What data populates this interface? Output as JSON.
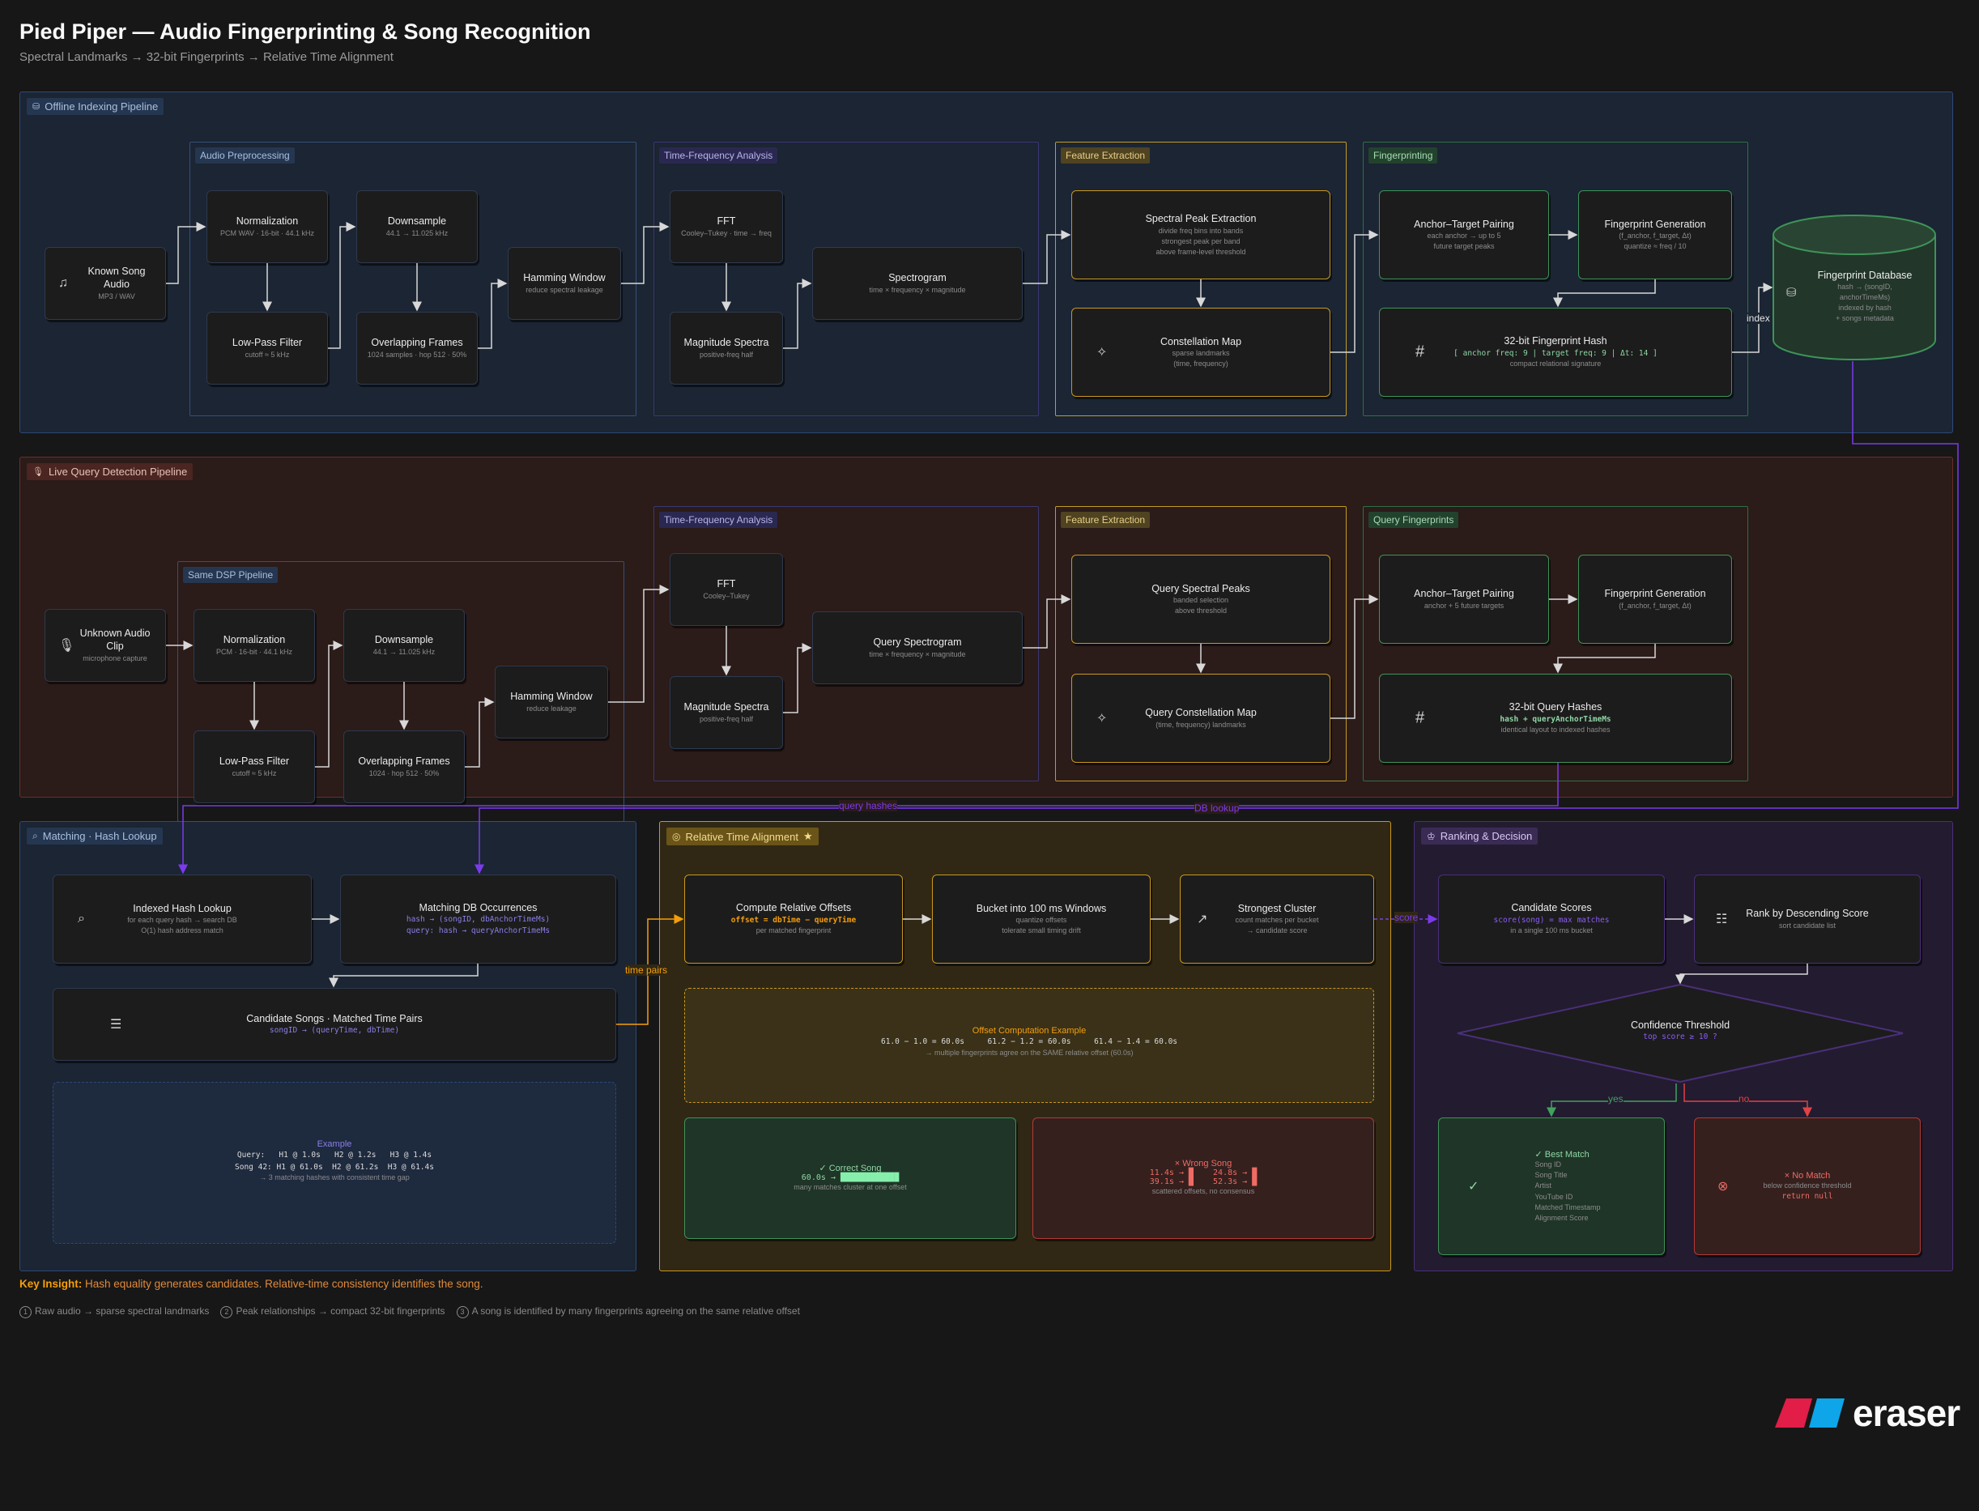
{
  "title": "Pied Piper — Audio Fingerprinting & Song Recognition",
  "subtitle": "Spectral Landmarks → 32-bit Fingerprints → Relative Time Alignment",
  "colors": {
    "background": "#171717",
    "blue": "#2d4a78",
    "red": "#6a2f2b",
    "gold": "#c9971f",
    "green": "#3e9358",
    "purple": "#7c3aed",
    "orange": "#f59e0b"
  },
  "offline": {
    "label": "Offline Indexing Pipeline",
    "icon": "database-icon",
    "groups": {
      "preprocessing": "Audio Preprocessing",
      "tfa": "Time-Frequency Analysis",
      "feature": "Feature Extraction",
      "fingerprinting": "Fingerprinting"
    },
    "nodes": {
      "known_song": {
        "title": "Known Song Audio",
        "sub": "MP3 / WAV"
      },
      "normalization": {
        "title": "Normalization",
        "sub": "PCM WAV · 16-bit · 44.1 kHz"
      },
      "lowpass": {
        "title": "Low-Pass Filter",
        "sub": "cutoff ≈ 5 kHz"
      },
      "downsample": {
        "title": "Downsample",
        "sub": "44.1 → 11.025 kHz"
      },
      "frames": {
        "title": "Overlapping Frames",
        "sub": "1024 samples · hop 512 · 50%"
      },
      "hamming": {
        "title": "Hamming Window",
        "sub": "reduce spectral leakage"
      },
      "fft": {
        "title": "FFT",
        "sub": "Cooley–Tukey · time → freq"
      },
      "magnitude": {
        "title": "Magnitude Spectra",
        "sub": "positive-freq half"
      },
      "spectrogram": {
        "title": "Spectrogram",
        "sub": "time × frequency × magnitude"
      },
      "peaks": {
        "title": "Spectral Peak Extraction",
        "sub": "divide freq bins into bands\nstrongest peak per band\nabove frame-level threshold"
      },
      "constellation": {
        "title": "Constellation Map",
        "sub": "sparse landmarks\n(time, frequency)"
      },
      "pairing": {
        "title": "Anchor–Target Pairing",
        "sub": "each anchor → up to 5\nfuture target peaks"
      },
      "fpgen": {
        "title": "Fingerprint Generation",
        "sub": "(f_anchor, f_target, Δt)\nquantize ≈ freq / 10"
      },
      "hash": {
        "title": "32-bit Fingerprint Hash",
        "code": "[ anchor freq: 9 | target freq: 9 | Δt: 14 ]",
        "sub": "compact relational signature"
      },
      "db": {
        "title": "Fingerprint Database",
        "sub": "hash → (songID,\nanchorTimeMs)\nindexed by hash\n+ songs metadata"
      }
    },
    "edge_index": "index"
  },
  "live": {
    "label": "Live Query Detection Pipeline",
    "icon": "microphone-icon",
    "groups": {
      "dsp": "Same DSP Pipeline",
      "tfa": "Time-Frequency Analysis",
      "feature": "Feature Extraction",
      "query_fp": "Query Fingerprints"
    },
    "nodes": {
      "unknown": {
        "title": "Unknown Audio Clip",
        "sub": "microphone capture"
      },
      "normalization": {
        "title": "Normalization",
        "sub": "PCM · 16-bit · 44.1 kHz"
      },
      "lowpass": {
        "title": "Low-Pass Filter",
        "sub": "cutoff ≈ 5 kHz"
      },
      "downsample": {
        "title": "Downsample",
        "sub": "44.1 → 11.025 kHz"
      },
      "frames": {
        "title": "Overlapping Frames",
        "sub": "1024 · hop 512 · 50%"
      },
      "hamming": {
        "title": "Hamming Window",
        "sub": "reduce leakage"
      },
      "fft": {
        "title": "FFT",
        "sub": "Cooley–Tukey"
      },
      "magnitude": {
        "title": "Magnitude Spectra",
        "sub": "positive-freq half"
      },
      "spectrogram": {
        "title": "Query Spectrogram",
        "sub": "time × frequency × magnitude"
      },
      "peaks": {
        "title": "Query Spectral Peaks",
        "sub": "banded selection\nabove threshold"
      },
      "constellation": {
        "title": "Query Constellation Map",
        "sub": "(time, frequency) landmarks"
      },
      "pairing": {
        "title": "Anchor–Target Pairing",
        "sub": "anchor + 5 future targets"
      },
      "fpgen": {
        "title": "Fingerprint Generation",
        "sub": "(f_anchor, f_target, Δt)"
      },
      "hashes": {
        "title": "32-bit Query Hashes",
        "code": "hash + queryAnchorTimeMs",
        "sub": "identical layout to indexed hashes"
      }
    },
    "edge_query_hashes": "query hashes",
    "edge_db_lookup": "DB lookup"
  },
  "matching": {
    "label": "Matching · Hash Lookup",
    "icon": "search-icon",
    "nodes": {
      "lookup": {
        "title": "Indexed Hash Lookup",
        "sub": "for each query hash → search DB\nO(1) hash address match"
      },
      "occurrences": {
        "title": "Matching DB Occurrences",
        "code": "hash → (songID, dbAnchorTimeMs)\nquery: hash → queryAnchorTimeMs"
      },
      "candidates": {
        "title": "Candidate Songs · Matched Time Pairs",
        "code": "songID → (queryTime, dbTime)"
      }
    },
    "example": {
      "title": "Example",
      "lines": "Query:   H1 @ 1.0s   H2 @ 1.2s   H3 @ 1.4s\nSong 42: H1 @ 61.0s  H2 @ 61.2s  H3 @ 61.4s",
      "note": "→ 3 matching hashes with consistent time gap"
    }
  },
  "alignment": {
    "label": "Relative Time Alignment",
    "star": "★",
    "edge_time_pairs": "time pairs",
    "nodes": {
      "offsets": {
        "title": "Compute Relative Offsets",
        "code": "offset = dbTime − queryTime",
        "sub": "per matched fingerprint"
      },
      "bucket": {
        "title": "Bucket into 100 ms Windows",
        "sub": "quantize offsets\ntolerate small timing drift"
      },
      "cluster": {
        "title": "Strongest Cluster",
        "sub": "count matches per bucket\n→ candidate score"
      }
    },
    "offset_example": {
      "title": "Offset Computation Example",
      "lines": "61.0 − 1.0 = 60.0s     61.2 − 1.2 = 60.0s     61.4 − 1.4 = 60.0s",
      "note": "→ multiple fingerprints agree on the SAME relative offset (60.0s)"
    },
    "correct": {
      "title": "✓ Correct Song",
      "code": "60.0s →",
      "bar": "████████████",
      "sub": "many matches cluster at one offset"
    },
    "wrong": {
      "title": "× Wrong Song",
      "row1": "11.4s → █    24.8s → █",
      "row2": "39.1s → █    52.3s → █",
      "sub": "scattered offsets, no consensus"
    }
  },
  "ranking": {
    "label": "Ranking & Decision",
    "icon": "award-icon",
    "edge_score": "score",
    "nodes": {
      "scores": {
        "title": "Candidate Scores",
        "code": "score(song) = max matches",
        "sub": "in a single 100 ms bucket"
      },
      "rank": {
        "title": "Rank by Descending Score",
        "sub": "sort candidate list"
      },
      "threshold": {
        "title": "Confidence Threshold",
        "code": "top score ≥ 10 ?"
      }
    },
    "edge_yes": "yes",
    "edge_no": "no",
    "best": {
      "title": "✓ Best Match",
      "items": "Song ID\nSong Title\nArtist\nYouTube ID\nMatched Timestamp\nAlignment Score"
    },
    "nomatch": {
      "title": "× No Match",
      "sub": "below confidence threshold",
      "code": "return null"
    }
  },
  "footer": {
    "insight_label": "Key Insight:",
    "insight_text": "Hash equality generates candidates. Relative-time consistency identifies the song.",
    "notes": [
      {
        "num": "1",
        "text": "Raw audio → sparse spectral landmarks"
      },
      {
        "num": "2",
        "text": "Peak relationships → compact 32-bit fingerprints"
      },
      {
        "num": "3",
        "text": "A song is identified by many fingerprints agreeing on the same relative offset"
      }
    ]
  },
  "brand": "eraser"
}
